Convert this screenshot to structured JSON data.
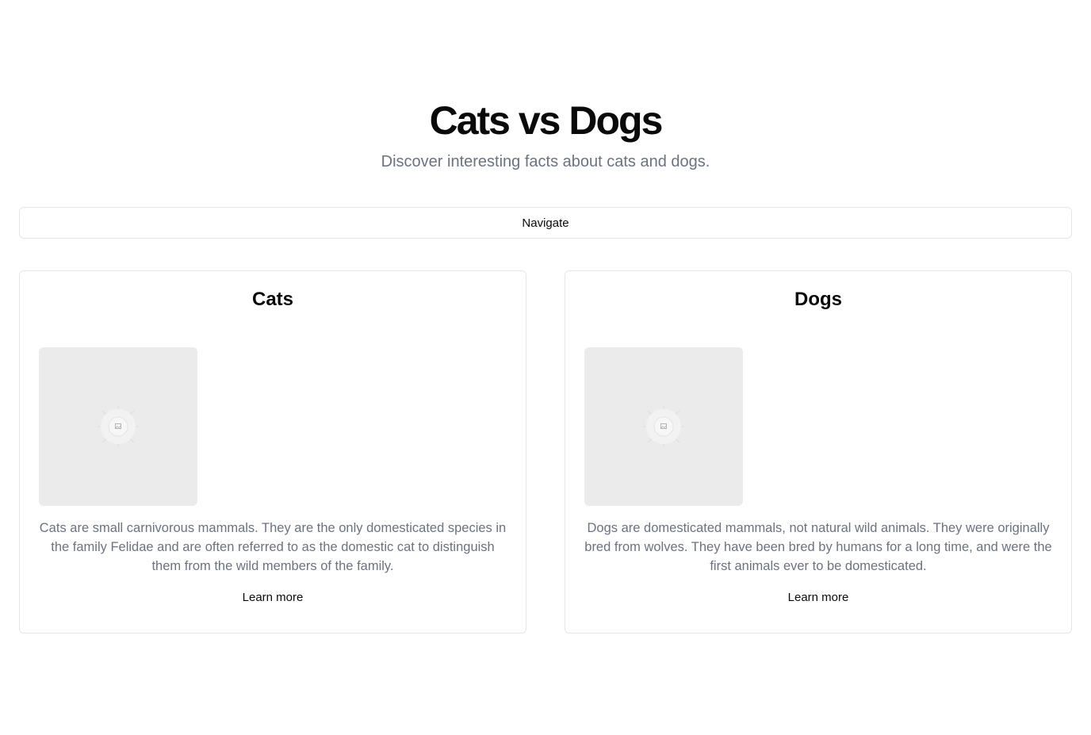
{
  "header": {
    "title": "Cats vs Dogs",
    "subtitle": "Discover interesting facts about cats and dogs."
  },
  "nav": {
    "label": "Navigate"
  },
  "cards": [
    {
      "title": "Cats",
      "image_icon": "image-placeholder-icon",
      "text": "Cats are small carnivorous mammals. They are the only domesticated species in the family Felidae and are often referred to as the domestic cat to distinguish them from the wild members of the family.",
      "link_label": "Learn more"
    },
    {
      "title": "Dogs",
      "image_icon": "image-placeholder-icon",
      "text": "Dogs are domesticated mammals, not natural wild animals. They were originally bred from wolves. They have been bred by humans for a long time, and were the first animals ever to be domesticated.",
      "link_label": "Learn more"
    }
  ],
  "colors": {
    "text_primary": "#0a0a0a",
    "text_muted": "#6b7280",
    "border": "#e5e5e5",
    "placeholder_bg": "#ebebeb"
  }
}
